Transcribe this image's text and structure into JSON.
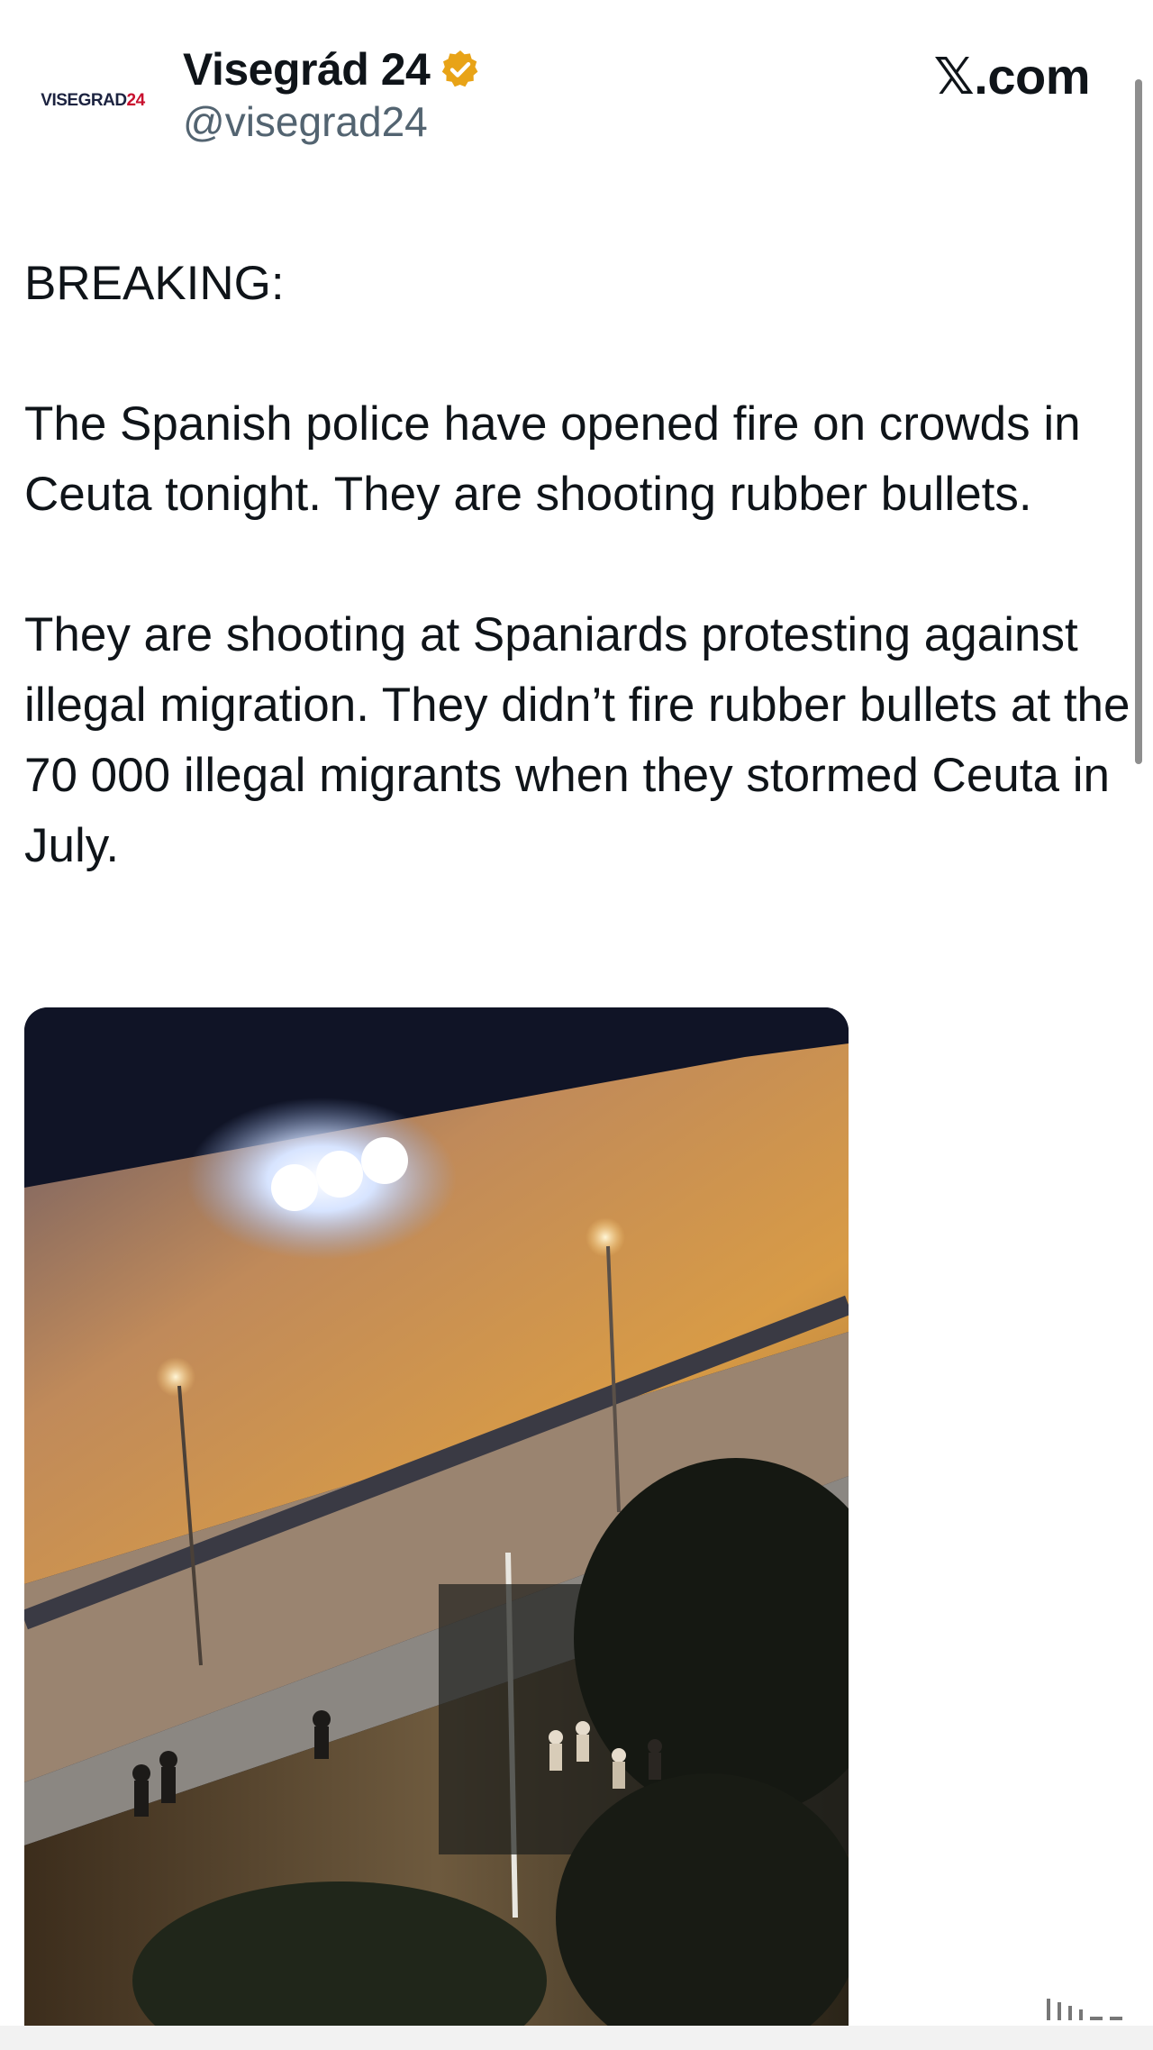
{
  "author": {
    "avatar_text": "VISEGRAD",
    "avatar_num": "24",
    "name": "Visegrád 24",
    "handle": "@visegrad24",
    "verified_icon": "verified-badge-icon",
    "verified_color": "#e8a317"
  },
  "site_label": "𝕏.com",
  "tweet": {
    "line1": "BREAKING:",
    "para2": "The Spanish police have opened fire on crowds in Ceuta tonight. They are shooting rubber bullets.",
    "para3": "They are shooting at Spaniards protesting against illegal migration. They didn’t fire rubber bullets at the 70 000 illegal migrants when they stormed Ceuta in July."
  },
  "media": {
    "type": "video-still"
  }
}
